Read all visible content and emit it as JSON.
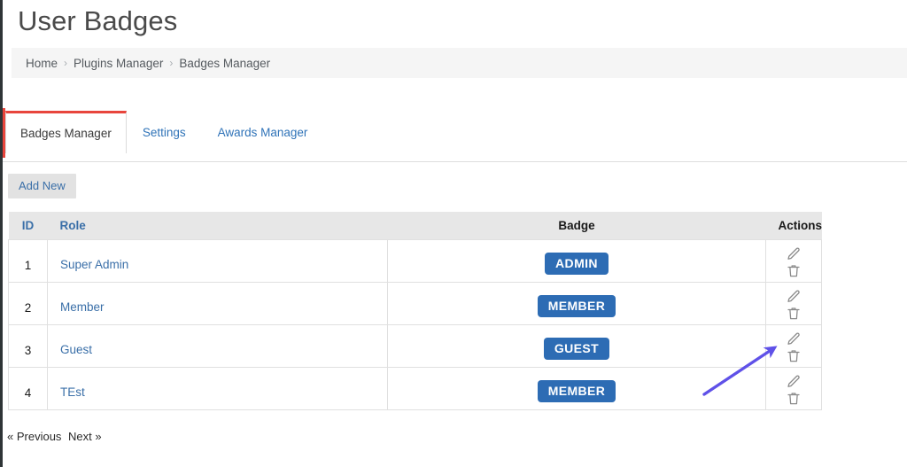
{
  "page": {
    "title": "User Badges"
  },
  "breadcrumb": {
    "separator": "›",
    "items": [
      {
        "label": "Home"
      },
      {
        "label": "Plugins Manager"
      },
      {
        "label": "Badges Manager"
      }
    ]
  },
  "tabs": [
    {
      "label": "Badges Manager",
      "active": true
    },
    {
      "label": "Settings",
      "active": false
    },
    {
      "label": "Awards Manager",
      "active": false
    }
  ],
  "toolbar": {
    "add_new_label": "Add New"
  },
  "table": {
    "headers": {
      "id": "ID",
      "role": "Role",
      "badge": "Badge",
      "actions": "Actions"
    },
    "rows": [
      {
        "id": "1",
        "role": "Super Admin",
        "badge": "ADMIN"
      },
      {
        "id": "2",
        "role": "Member",
        "badge": "MEMBER"
      },
      {
        "id": "3",
        "role": "Guest",
        "badge": "GUEST"
      },
      {
        "id": "4",
        "role": "TEst",
        "badge": "MEMBER"
      }
    ],
    "row_actions": [
      {
        "name": "edit-icon",
        "title": "Edit"
      },
      {
        "name": "delete-icon",
        "title": "Delete"
      }
    ]
  },
  "pagination": {
    "previous_label": "« Previous",
    "next_label": "Next »"
  },
  "colors": {
    "accent_red": "#e8453c",
    "link_blue": "#3a6fa8",
    "badge_blue": "#2d6cb4",
    "header_gray": "#e7e7e7",
    "breadcrumb_gray": "#f5f5f5",
    "annotation_arrow": "#5f51e8"
  }
}
